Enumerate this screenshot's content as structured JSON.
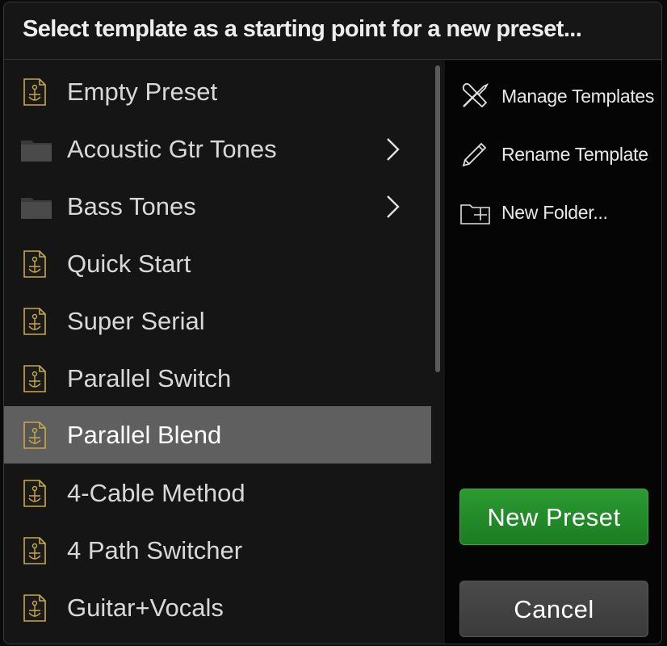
{
  "dialog": {
    "title": "Select template as a starting point for a new preset..."
  },
  "templates": [
    {
      "label": "Empty Preset",
      "type": "template",
      "icon": "template-icon"
    },
    {
      "label": "Acoustic Gtr Tones",
      "type": "folder",
      "icon": "folder-icon"
    },
    {
      "label": "Bass Tones",
      "type": "folder",
      "icon": "folder-icon"
    },
    {
      "label": "Quick Start",
      "type": "template",
      "icon": "template-icon"
    },
    {
      "label": "Super Serial",
      "type": "template",
      "icon": "template-icon"
    },
    {
      "label": "Parallel Switch",
      "type": "template",
      "icon": "template-icon"
    },
    {
      "label": "Parallel Blend",
      "type": "template",
      "icon": "template-icon",
      "selected": true
    },
    {
      "label": "4-Cable Method",
      "type": "template",
      "icon": "template-icon"
    },
    {
      "label": "4 Path Switcher",
      "type": "template",
      "icon": "template-icon"
    },
    {
      "label": "Guitar+Vocals",
      "type": "template",
      "icon": "template-icon"
    }
  ],
  "actions": {
    "manage_templates": "Manage Templates",
    "rename_template": "Rename Template",
    "new_folder": "New Folder..."
  },
  "buttons": {
    "new_preset": "New Preset",
    "cancel": "Cancel"
  },
  "colors": {
    "accent_green": "#1f8a25",
    "selection": "#5f5f5f",
    "template_icon": "#c8a84a"
  }
}
